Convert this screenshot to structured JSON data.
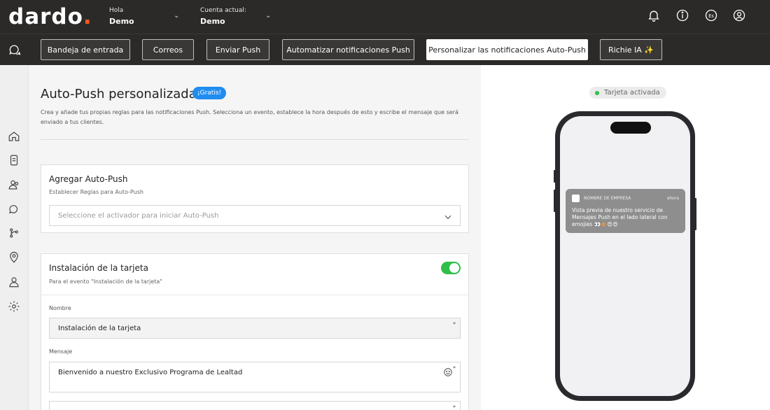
{
  "header": {
    "logo_main": "dard",
    "logo_o": "o",
    "logo_dot": ".",
    "greeting_label": "Hola",
    "greeting_name": "Demo",
    "account_label": "Cuenta actual:",
    "account_name": "Demo",
    "language_badge": "Es",
    "icons": [
      "bell-icon",
      "info-icon",
      "language-icon",
      "user-icon"
    ]
  },
  "nav": {
    "buttons": [
      {
        "label": "Bandeja de entrada"
      },
      {
        "label": "Correos"
      },
      {
        "label": "Enviar Push"
      },
      {
        "label": "Automatizar notificaciones Push"
      },
      {
        "label": "Personalizar las notificaciones Auto-Push",
        "active": true
      },
      {
        "label": "Richie IA ✨"
      }
    ]
  },
  "sidebar": {
    "icons": [
      "home-icon",
      "card-icon",
      "users-icon",
      "chat-icon",
      "flow-icon",
      "location-icon",
      "person-icon",
      "gear-icon"
    ]
  },
  "main": {
    "title": "Auto-Push personalizada",
    "badge": "¡Gratis!",
    "description": "Crea y añade tus propias reglas para las notificaciones Push. Selecciona un evento, establece la hora después de esto y escribe el mensaje que será enviado a tus clientes.",
    "add_card": {
      "title": "Agregar Auto-Push",
      "subtitle": "Establecer Reglas para Auto-Push",
      "select_placeholder": "Seleccione el activador para iniciar Auto-Push"
    },
    "install_card": {
      "title": "Instalación de la tarjeta",
      "subtitle": "Para el evento \"Instalación de la tarjeta\"",
      "toggle_on": true,
      "name_label": "Nombre",
      "name_value": "Instalación de la tarjeta",
      "message_label": "Mensaje",
      "message_value": "Bienvenido a nuestro Exclusivo Programa de Lealtad",
      "required_mark": "*"
    }
  },
  "preview": {
    "status": "Tarjeta activada",
    "notification": {
      "company": "NOMBRE DE EMPRESA",
      "time": "ahora",
      "body": "Vista previa de nuestro servicio de Mensajes Push en el lado lateral con emojies 👀🙈😍😍"
    }
  },
  "colors": {
    "header_bg": "#2c2a29",
    "accent_orange": "#ff5a1f",
    "badge_blue": "#1f8cf0",
    "toggle_green": "#2fbf4a"
  }
}
